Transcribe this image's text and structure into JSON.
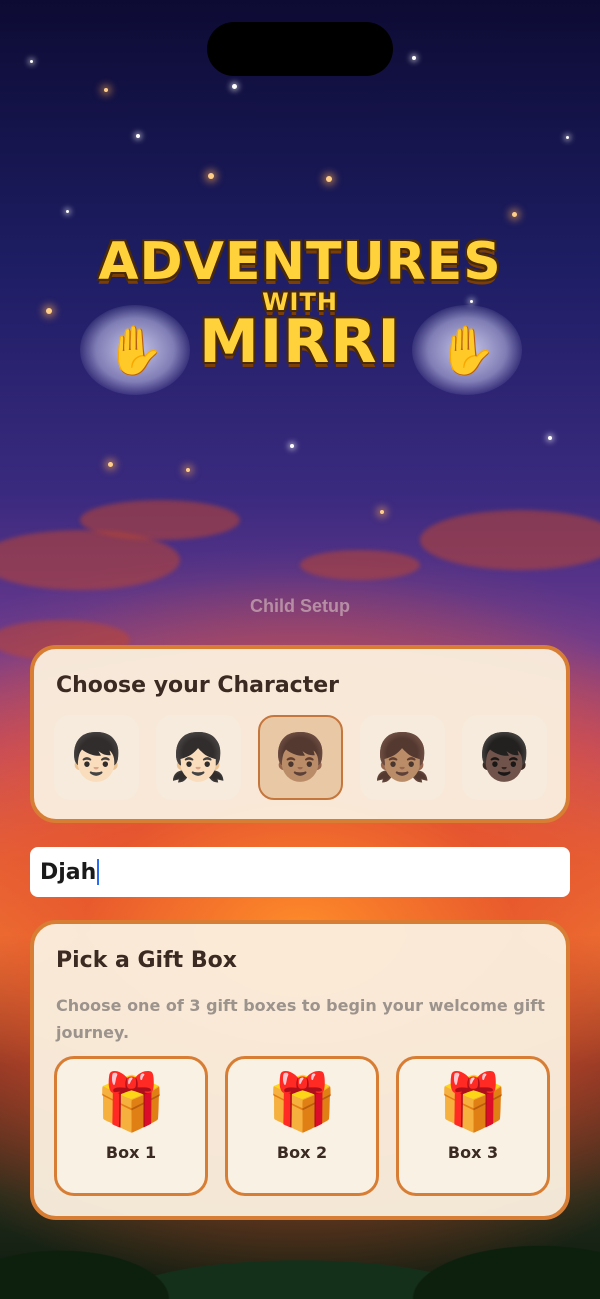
{
  "logo": {
    "line1": "ADVENTURES",
    "line2": "WITH",
    "line3": "MIRRI",
    "icons": [
      "handprint-icon",
      "handprint-icon"
    ]
  },
  "subtitle": "Child Setup",
  "character_card": {
    "title": "Choose your Character",
    "characters": [
      {
        "glyph": "👦🏻",
        "selected": false
      },
      {
        "glyph": "👧🏻",
        "selected": false
      },
      {
        "glyph": "👦🏽",
        "selected": true
      },
      {
        "glyph": "👧🏽",
        "selected": false
      },
      {
        "glyph": "👦🏿",
        "selected": false
      }
    ]
  },
  "name_input": {
    "value": "Djah"
  },
  "gift_card": {
    "title": "Pick a Gift Box",
    "description": "Choose one of 3 gift boxes to begin your welcome gift journey.",
    "boxes": [
      {
        "icon": "🎁",
        "label": "Box 1"
      },
      {
        "icon": "🎁",
        "label": "Box 2"
      },
      {
        "icon": "🎁",
        "label": "Box 3"
      }
    ]
  },
  "colors": {
    "card_border": "#d77d34",
    "card_bg": "#faeede",
    "logo_yellow": "#ffd23b",
    "caret": "#2a6df4"
  }
}
